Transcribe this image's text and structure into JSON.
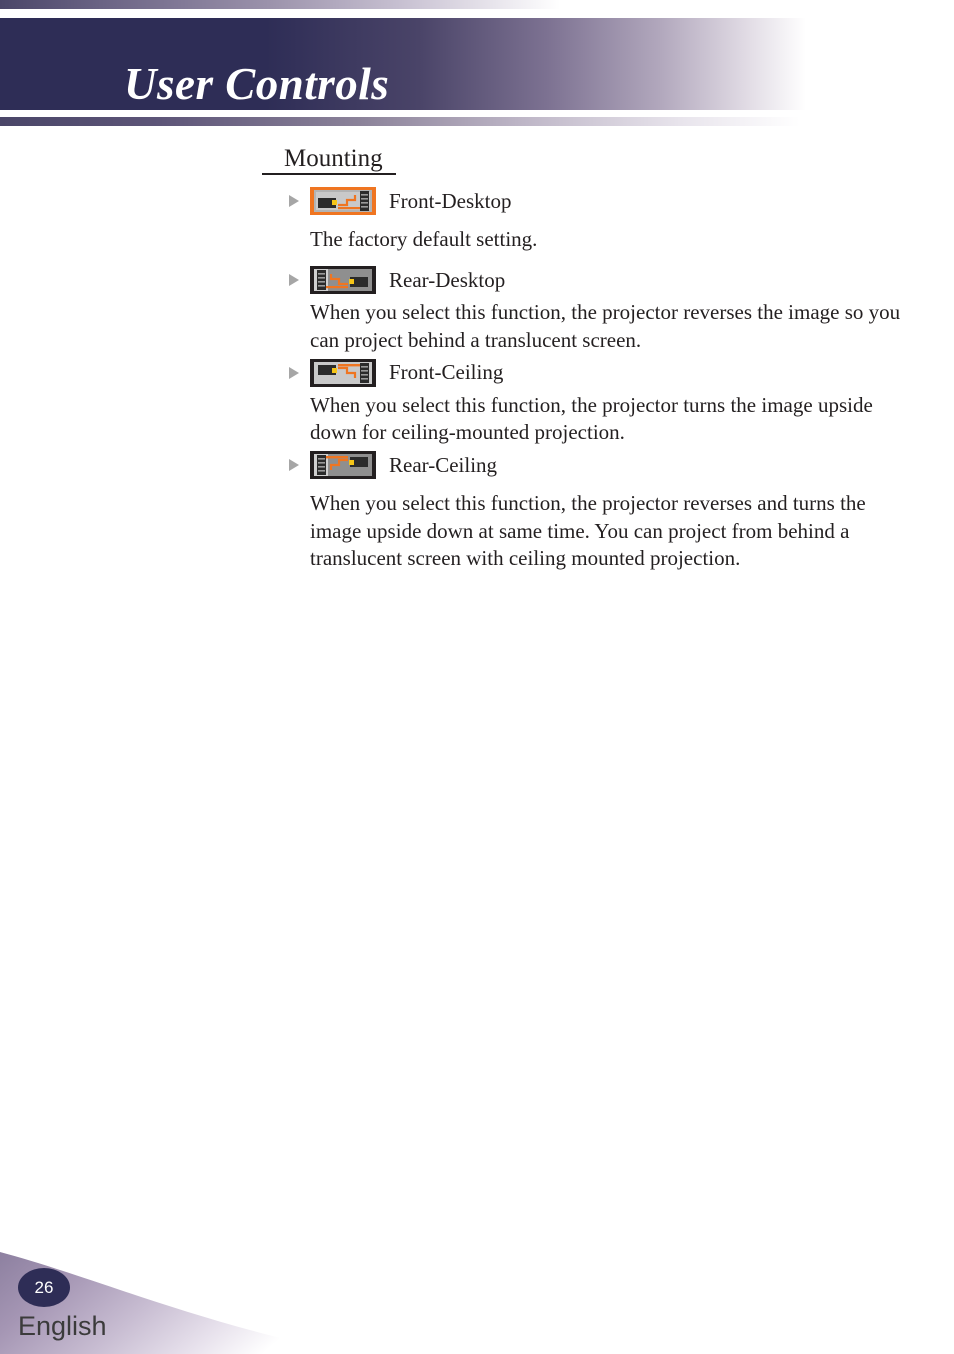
{
  "header": {
    "title": "User Controls",
    "accent_dark": "#2e2d56",
    "accent_mid": "#6a6384"
  },
  "section": {
    "heading": "Mounting"
  },
  "mount_options": [
    {
      "icon": "projector-front-desktop-icon",
      "label": "Front-Desktop",
      "description": "The factory default setting.",
      "icon_style": "orange-highlight"
    },
    {
      "icon": "projector-rear-desktop-icon",
      "label": "Rear-Desktop",
      "description": "When you select this function, the projector reverses the image so you can project behind a translucent screen.",
      "icon_style": "dark"
    },
    {
      "icon": "projector-front-ceiling-icon",
      "label": "Front-Ceiling",
      "description": "When you select this function, the projector turns the image upside down for ceiling-mounted projection.",
      "icon_style": "dark"
    },
    {
      "icon": "projector-rear-ceiling-icon",
      "label": "Rear-Ceiling",
      "description": "When you select this function, the projector reverses and turns the image upside down at same time. You can project from behind a translucent screen with ceiling mounted projection.",
      "icon_style": "dark"
    }
  ],
  "footer": {
    "page_number": "26",
    "language": "English",
    "badge_color": "#2e2d56"
  }
}
